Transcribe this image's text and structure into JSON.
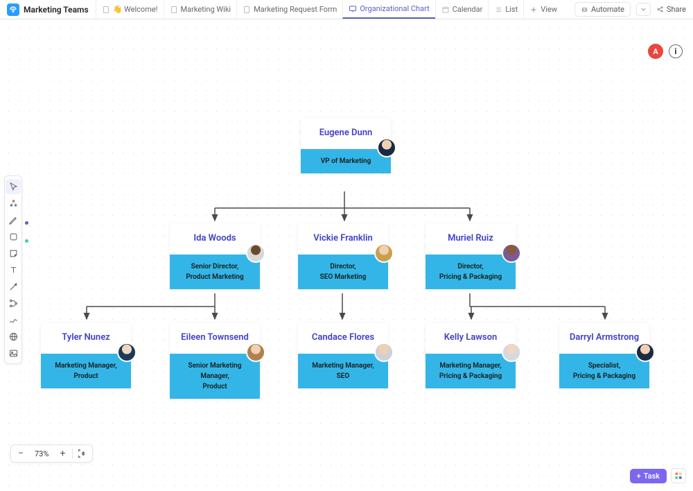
{
  "header": {
    "app_title": "Marketing Teams",
    "tabs": [
      {
        "id": "welcome",
        "label": "👋 Welcome!",
        "icon": "doc"
      },
      {
        "id": "wiki",
        "label": "Marketing Wiki",
        "icon": "doc"
      },
      {
        "id": "request",
        "label": "Marketing Request Form",
        "icon": "doc"
      },
      {
        "id": "orgchart",
        "label": "Organizational Chart",
        "icon": "whiteboard",
        "active": true
      },
      {
        "id": "calendar",
        "label": "Calendar",
        "icon": "calendar"
      },
      {
        "id": "list",
        "label": "List",
        "icon": "list"
      },
      {
        "id": "addview",
        "label": "View",
        "icon": "plus"
      }
    ],
    "automate_label": "Automate",
    "share_label": "Share",
    "user_initial": "A"
  },
  "toolbar": {
    "tools": [
      "pointer",
      "hierarchy",
      "pen",
      "shape",
      "sticky",
      "text",
      "connector",
      "branch",
      "scribble",
      "globe",
      "image"
    ]
  },
  "zoom": {
    "percent": "73%"
  },
  "bottom": {
    "task_label": "Task"
  },
  "chart_data": {
    "type": "hierarchy",
    "title": "Organizational Chart",
    "accent_color": "#33b6e7",
    "nodes": [
      {
        "id": "eugene",
        "name": "Eugene Dunn",
        "title": "VP of Marketing",
        "parent": null
      },
      {
        "id": "ida",
        "name": "Ida Woods",
        "title": "Senior Director,\nProduct Marketing",
        "parent": "eugene"
      },
      {
        "id": "vickie",
        "name": "Vickie Franklin",
        "title": "Director,\nSEO Marketing",
        "parent": "eugene"
      },
      {
        "id": "muriel",
        "name": "Muriel Ruiz",
        "title": "Director,\nPricing & Packaging",
        "parent": "eugene"
      },
      {
        "id": "tyler",
        "name": "Tyler Nunez",
        "title": "Marketing Manager,\nProduct",
        "parent": "ida"
      },
      {
        "id": "eileen",
        "name": "Eileen Townsend",
        "title": "Senior Marketing Manager,\nProduct",
        "parent": "ida"
      },
      {
        "id": "candace",
        "name": "Candace Flores",
        "title": "Marketing Manager,\nSEO",
        "parent": "vickie"
      },
      {
        "id": "kelly",
        "name": "Kelly Lawson",
        "title": "Marketing Manager,\nPricing & Packaging",
        "parent": "muriel"
      },
      {
        "id": "darryl",
        "name": "Darryl Armstrong",
        "title": "Specialist,\nPricing & Packaging",
        "parent": "muriel"
      }
    ]
  }
}
